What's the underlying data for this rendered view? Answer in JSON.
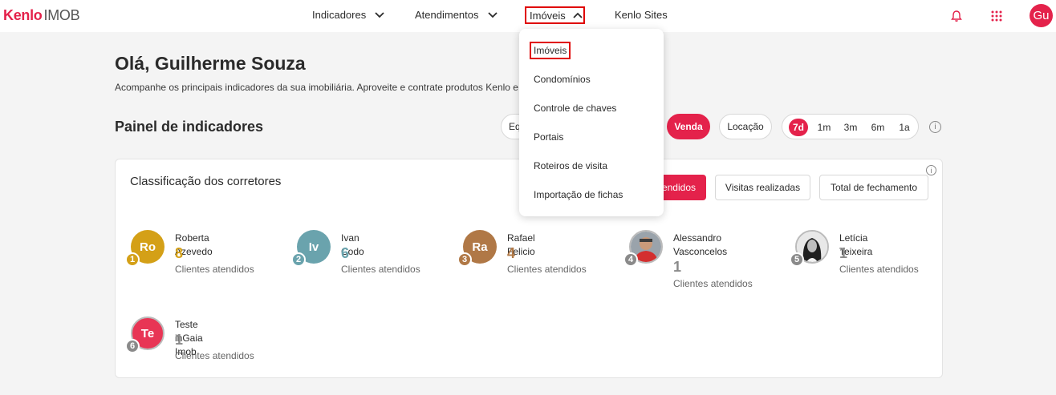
{
  "header": {
    "logo_brand": "Kenlo",
    "logo_product": "IMOB",
    "nav": {
      "indicadores": "Indicadores",
      "atendimentos": "Atendimentos",
      "imoveis": "Imóveis",
      "sites": "Kenlo Sites"
    },
    "user_initials": "Gu"
  },
  "greeting": "Olá, Guilherme Souza",
  "subtitle": "Acompanhe os principais indicadores da sua imobiliária. Aproveite e contrate produtos Kenlo e f",
  "panel_title": "Painel de indicadores",
  "filters": {
    "team_partial": "Eq",
    "venda": "Venda",
    "locacao": "Locação",
    "periods": [
      "7d",
      "1m",
      "3m",
      "6m",
      "1a"
    ],
    "info": "i"
  },
  "ranking": {
    "title": "Classificação dos corretores",
    "info": "i",
    "tabs": {
      "atendidos_partial": "endidos",
      "visitas": "Visitas realizadas",
      "fechamento": "Total de fechamento"
    },
    "metric_label": "Clientes atendidos",
    "brokers": [
      {
        "rank": "1",
        "initials": "Ro",
        "name": "Roberta Azevedo",
        "value": "8",
        "color": "#d4a017"
      },
      {
        "rank": "2",
        "initials": "Iv",
        "name": "Ivan Codo",
        "value": "6",
        "color": "#6aa3ad"
      },
      {
        "rank": "3",
        "initials": "Ra",
        "name": "Rafael Felicio",
        "value": "4",
        "color": "#b07846"
      },
      {
        "rank": "4",
        "initials": "",
        "name_line1": "Alessandro",
        "name_line2": "Vasconcelos",
        "value": "1",
        "color": "#8a8a8a"
      },
      {
        "rank": "5",
        "initials": "",
        "name": "Letícia Teixeira",
        "value": "1",
        "color": "#8a8a8a"
      },
      {
        "rank": "6",
        "initials": "Te",
        "name": "Teste inGaia Imob",
        "value": "1",
        "color": "#8a8a8a",
        "avatar_color": "#e83555"
      }
    ]
  },
  "dropdown": {
    "items": [
      "Imóveis",
      "Condomínios",
      "Controle de chaves",
      "Portais",
      "Roteiros de visita",
      "Importação de fichas"
    ]
  },
  "colors": {
    "accent": "#e4224b",
    "highlight_border": "#e00000"
  }
}
